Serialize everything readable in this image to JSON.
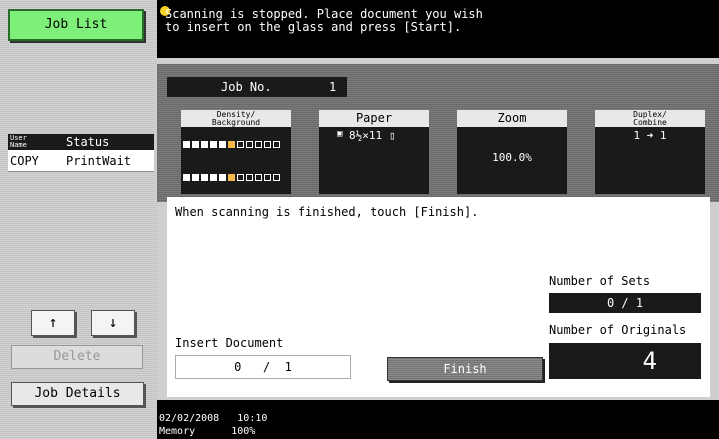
{
  "left_panel": {
    "job_list_label": "Job List",
    "table": {
      "col1_header": "User\nName",
      "col2_header": "Status",
      "rows": [
        {
          "name": "COPY",
          "status": "PrintWait"
        }
      ]
    },
    "up_arrow": "↑",
    "down_arrow": "↓",
    "delete_label": "Delete",
    "job_details_label": "Job Details"
  },
  "message": {
    "text": "Scanning is stopped. Place document you wish\nto insert on the glass and press [Start]."
  },
  "job": {
    "label": "Job No.",
    "value": "1"
  },
  "settings": {
    "density_label": "Density/\nBackground",
    "paper_label": "Paper",
    "paper_value": "8½×11",
    "zoom_label": "Zoom",
    "zoom_value": "100.0%",
    "duplex_label": "Duplex/\nCombine",
    "duplex_value": "1 ➜ 1"
  },
  "body": {
    "instruction": "When scanning is finished, touch [Finish].",
    "number_of_sets_label": "Number of Sets",
    "number_of_sets_value": "0 / 1",
    "number_of_originals_label": "Number of Originals",
    "number_of_originals_value": "4",
    "insert_document_label": "Insert Document",
    "insert_document_value": "0   /  1",
    "finish_label": "Finish"
  },
  "footer": {
    "date": "02/02/2008",
    "time": "10:10",
    "memory_label": "Memory",
    "memory_value": "100%"
  },
  "colors": {
    "job_list_green": "#7ef07a",
    "message_icon_yellow": "#f5d020"
  }
}
